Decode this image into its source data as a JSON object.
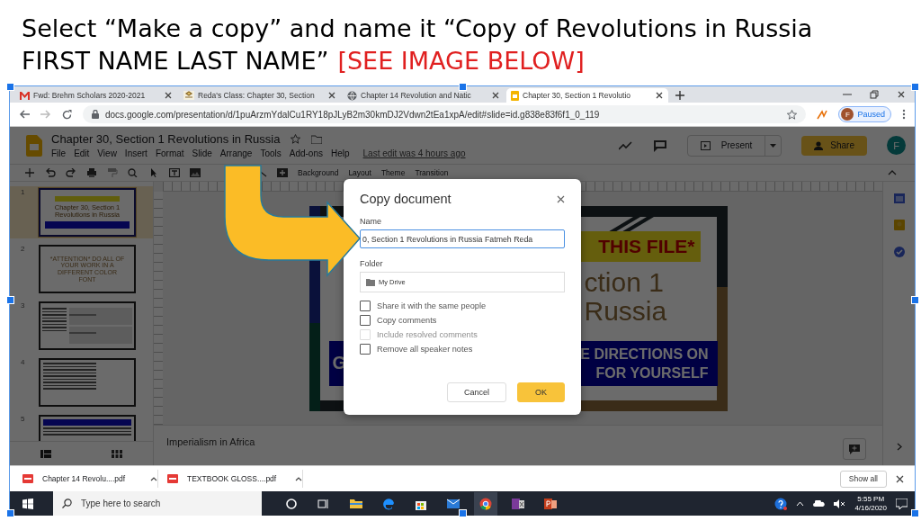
{
  "instruction": {
    "line_1": "Select “Make a copy” and name it “Copy of Revolutions in Russia",
    "line_2": "FIRST NAME LAST NAME”",
    "highlight": "[SEE IMAGE BELOW]"
  },
  "browser": {
    "tabs": [
      {
        "title": "Fwd: Brehm Scholars 2020-2021",
        "selected": false
      },
      {
        "title": "Reda's Class: Chapter 30, Section",
        "selected": false
      },
      {
        "title": "Chapter 14 Revolution and Natic",
        "selected": false
      },
      {
        "title": "Chapter 30, Section 1 Revolutio",
        "selected": true
      }
    ],
    "address": "docs.google.com/presentation/d/1puArzmYdalCu1RY18pJLyB2m30kmDJ2Vdwn2tEa1xpA/edit#slide=id.g838e83f6f1_0_119",
    "profile": {
      "initial": "F",
      "status": "Paused"
    }
  },
  "slides_app": {
    "title": "Chapter 30, Section 1 Revolutions in Russia",
    "menu": [
      "File",
      "Edit",
      "View",
      "Insert",
      "Format",
      "Slide",
      "Arrange",
      "Tools",
      "Add-ons",
      "Help"
    ],
    "last_edit": "Last edit was 4 hours ago",
    "present": "Present",
    "share": "Share",
    "avatar": "F",
    "toolbar_labels": [
      "Background",
      "Layout",
      "Theme",
      "Transition"
    ],
    "thumbnails": [
      {
        "number": "1",
        "kind": "title",
        "selected": true,
        "text": "Chapter 30, Section 1 Revolutions in Russia"
      },
      {
        "number": "2",
        "kind": "notice",
        "selected": false,
        "text": "*ATTENTION* DO ALL OF YOUR WORK IN A DIFFERENT COLOR FONT"
      },
      {
        "number": "3",
        "kind": "text_image",
        "selected": false
      },
      {
        "number": "4",
        "kind": "list",
        "selected": false
      },
      {
        "number": "5",
        "kind": "heading",
        "selected": false
      }
    ],
    "slide": {
      "band": "THIS FILE*",
      "title_line_1": "ction 1",
      "title_line_2": "Russia",
      "banner_left": "G",
      "banner_line_1": "E DIRECTIONS ON",
      "banner_line_2": "FOR YOURSELF"
    },
    "notes": "Imperialism in Africa"
  },
  "dialog": {
    "title": "Copy document",
    "name_label": "Name",
    "name_value": "0, Section 1 Revolutions in Russia Fatmeh Reda",
    "folder_label": "Folder",
    "folder": "My Drive",
    "options": [
      {
        "label": "Share it with the same people",
        "checked": false,
        "disabled": false
      },
      {
        "label": "Copy comments",
        "checked": false,
        "disabled": false
      },
      {
        "label": "Include resolved comments",
        "checked": false,
        "disabled": true
      },
      {
        "label": "Remove all speaker notes",
        "checked": false,
        "disabled": false
      }
    ],
    "buttons": [
      {
        "label": "Cancel",
        "kind": "secondary"
      },
      {
        "label": "OK",
        "kind": "primary"
      }
    ]
  },
  "downloads": {
    "files": [
      "Chapter 14 Revolu....pdf",
      "TEXTBOOK GLOSS....pdf"
    ],
    "show_all": "Show all"
  },
  "taskbar": {
    "search_placeholder": "Type here to search",
    "time": "5:55 PM",
    "date": "4/16/2020"
  }
}
